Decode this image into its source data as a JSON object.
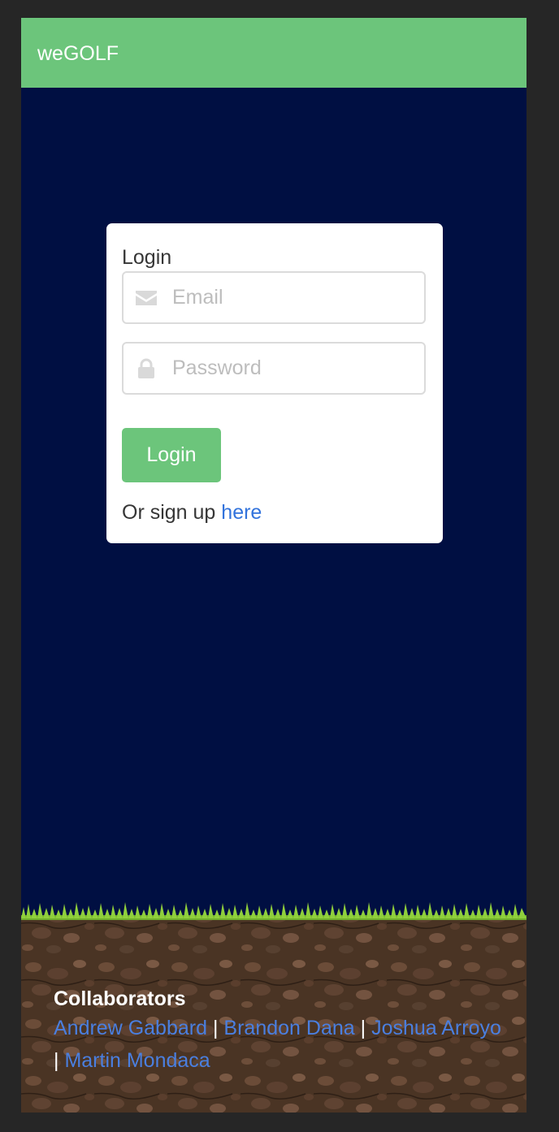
{
  "navbar": {
    "brand": "weGOLF"
  },
  "login": {
    "title": "Login",
    "email_placeholder": "Email",
    "password_placeholder": "Password",
    "button_label": "Login",
    "signup_text": "Or sign up",
    "signup_link": "here"
  },
  "footer": {
    "title": "Collaborators",
    "collaborators": [
      "Andrew Gabbard",
      "Brandon Dana",
      "Joshua Arroyo",
      "Martin Mondaca"
    ],
    "separator": "|"
  },
  "colors": {
    "navbar": "#6cc57b",
    "background": "#000f42",
    "link": "#3273dc",
    "grass": "#8fcf3c",
    "soil": "#4a3424"
  },
  "icons": {
    "email": "envelope-icon",
    "password": "lock-icon"
  }
}
